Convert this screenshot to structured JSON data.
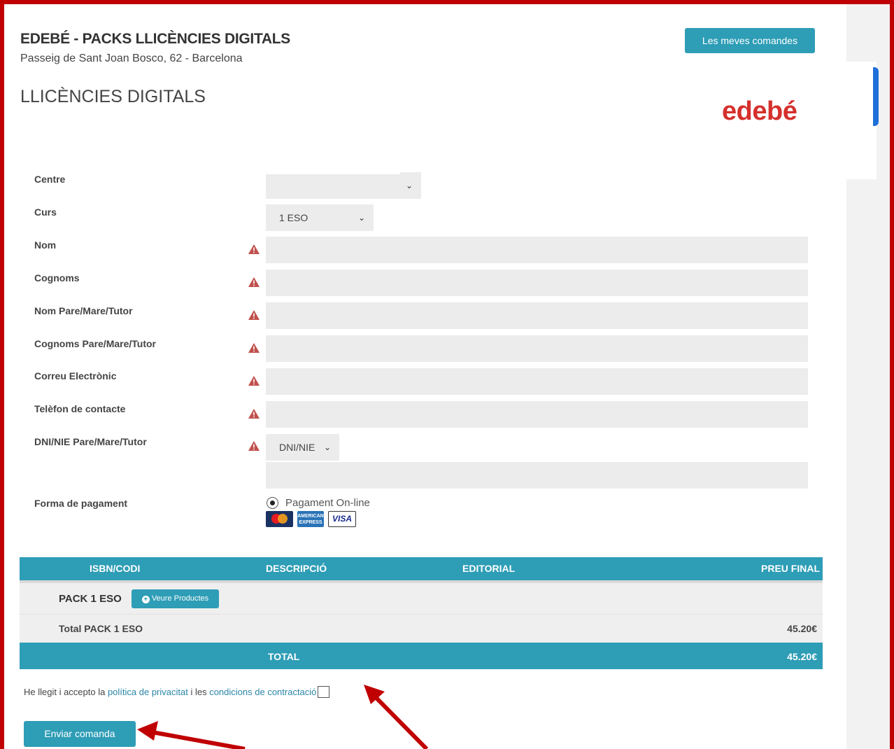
{
  "header": {
    "company_name": "EDEBÉ - PACKS LLICÈNCIES DIGITALS",
    "address": "Passeig de Sant Joan Bosco, 62 - Barcelona",
    "orders_button": "Les meves comandes",
    "page_title": "LLICÈNCIES DIGITALS",
    "logo_text": "edebé"
  },
  "form": {
    "centre_label": "Centre",
    "centre_value": "",
    "curs_label": "Curs",
    "curs_value": "1 ESO",
    "nom_label": "Nom",
    "cognoms_label": "Cognoms",
    "nom_tutor_label": "Nom Pare/Mare/Tutor",
    "cognoms_tutor_label": "Cognoms Pare/Mare/Tutor",
    "email_label": "Correu Electrònic",
    "phone_label": "Telèfon de contacte",
    "dni_label": "DNI/NIE Pare/Mare/Tutor",
    "dni_type_value": "DNI/NIE",
    "payment_label": "Forma de pagament",
    "payment_option": "Pagament On-line",
    "cards": {
      "mastercard": "MasterCard",
      "amex": "AMERICAN EXPRESS",
      "visa": "VISA"
    }
  },
  "table": {
    "headers": [
      "ISBN/CODI",
      "DESCRIPCIÓ",
      "EDITORIAL",
      "PREU FINAL"
    ],
    "pack_name": "PACK 1 ESO",
    "products_button": "Veure Productes",
    "pack_total_label": "Total PACK 1 ESO",
    "pack_total_value": "45.20€",
    "total_label": "TOTAL",
    "total_value": "45.20€"
  },
  "footer": {
    "accept_prefix": "He llegit i accepto la ",
    "privacy_link": "política de privacitat",
    "accept_middle": " i les ",
    "conditions_link": "condicions de contractació",
    "submit_button": "Enviar comanda"
  },
  "colors": {
    "accent": "#2e9db6",
    "brand_red": "#d5302c",
    "annotation_red": "#c00000",
    "warning": "#c0504d"
  }
}
